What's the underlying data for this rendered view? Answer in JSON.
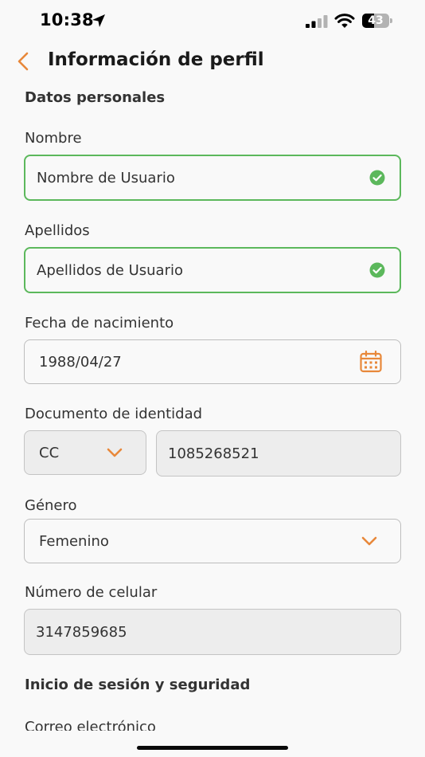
{
  "status_bar": {
    "time": "10:38",
    "battery_level": "43",
    "battery_fraction": 0.43
  },
  "header": {
    "title": "Información de perfil",
    "back_icon": "chevron-left-icon"
  },
  "sections": {
    "personal": "Datos personales",
    "login": "Inicio de sesión y seguridad"
  },
  "fields": {
    "nombre": {
      "label": "Nombre",
      "value": "Nombre de Usuario"
    },
    "apellidos": {
      "label": "Apellidos",
      "value": "Apellidos de Usuario"
    },
    "fecha": {
      "label": "Fecha de nacimiento",
      "value": "1988/04/27"
    },
    "documento": {
      "label": "Documento de identidad",
      "type_value": "CC",
      "number_value": "1085268521"
    },
    "genero": {
      "label": "Género",
      "value": "Femenino"
    },
    "celular": {
      "label": "Número de celular",
      "value": "3147859685"
    },
    "correo": {
      "label": "Correo electrónico"
    }
  },
  "colors": {
    "accent": "#e8883a",
    "valid": "#5cb85c",
    "disabled_bg": "#ededed"
  }
}
